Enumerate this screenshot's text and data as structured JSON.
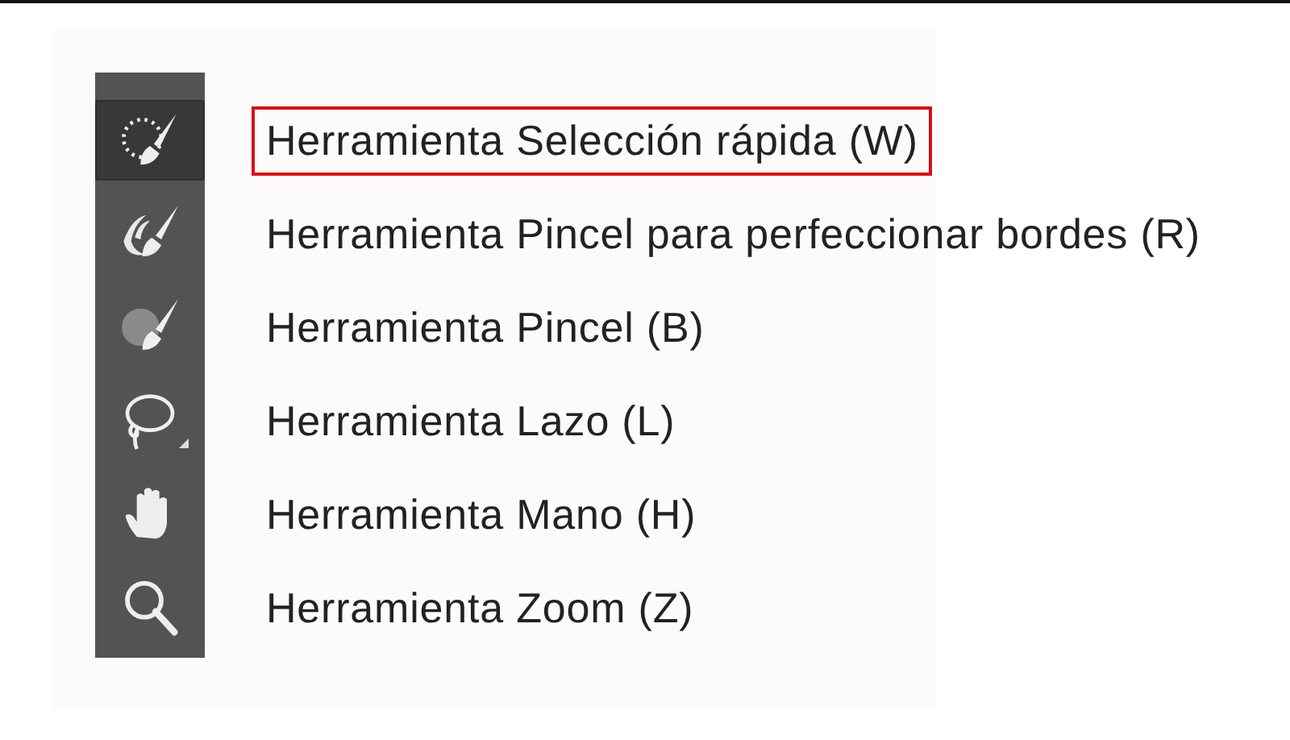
{
  "tools": [
    {
      "kind": "quick-selection",
      "label": "Herramienta Selección rápida (W)",
      "selected": true,
      "highlighted": true,
      "has_flyout": false
    },
    {
      "kind": "refine-brush",
      "label": "Herramienta Pincel para perfeccionar bordes (R)",
      "selected": false,
      "highlighted": false,
      "has_flyout": false
    },
    {
      "kind": "brush",
      "label": "Herramienta Pincel (B)",
      "selected": false,
      "highlighted": false,
      "has_flyout": false
    },
    {
      "kind": "lasso",
      "label": "Herramienta Lazo (L)",
      "selected": false,
      "highlighted": false,
      "has_flyout": true
    },
    {
      "kind": "hand",
      "label": "Herramienta Mano (H)",
      "selected": false,
      "highlighted": false,
      "has_flyout": false
    },
    {
      "kind": "zoom",
      "label": "Herramienta Zoom (Z)",
      "selected": false,
      "highlighted": false,
      "has_flyout": false
    }
  ]
}
